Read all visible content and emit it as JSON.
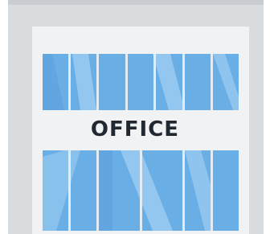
{
  "building": {
    "sign_text": "OFFICE",
    "icon": "office-building-icon"
  },
  "colors": {
    "outer_wall": "#d9dcdf",
    "outer_wall_edge": "#c9ccd0",
    "facade": "#f1f2f3",
    "glass": "#6aaee6",
    "glass_light": "#9fcdf1",
    "glass_dark": "#4f97d6",
    "mullion": "#e3ecf4",
    "sign": "#222831"
  }
}
